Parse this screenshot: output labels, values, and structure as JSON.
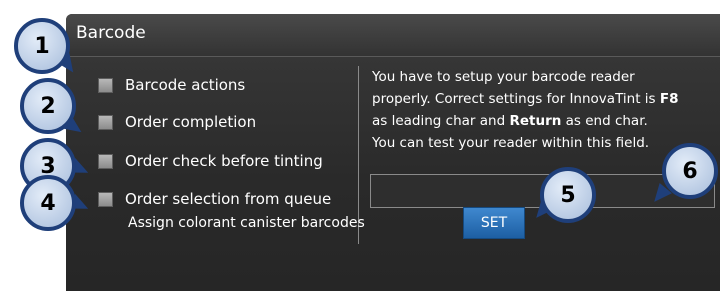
{
  "window": {
    "title": "Barcode"
  },
  "options": [
    {
      "label": "Barcode actions"
    },
    {
      "label": "Order completion"
    },
    {
      "label": "Order check before tinting"
    },
    {
      "label": "Order selection from queue"
    }
  ],
  "info": {
    "line1": "You have to setup your barcode reader",
    "line2_a": "properly. Correct settings for InnovaTint is ",
    "line2_key": "F8",
    "line3_a": "as leading char and ",
    "line3_key": "Return",
    "line3_b": " as end char.",
    "line4": "You can test your reader within this field."
  },
  "test_field": {
    "value": ""
  },
  "assign_label": "Assign colorant canister barcodes",
  "set_button": "SET",
  "callouts": [
    "1",
    "2",
    "3",
    "4",
    "5",
    "6"
  ]
}
